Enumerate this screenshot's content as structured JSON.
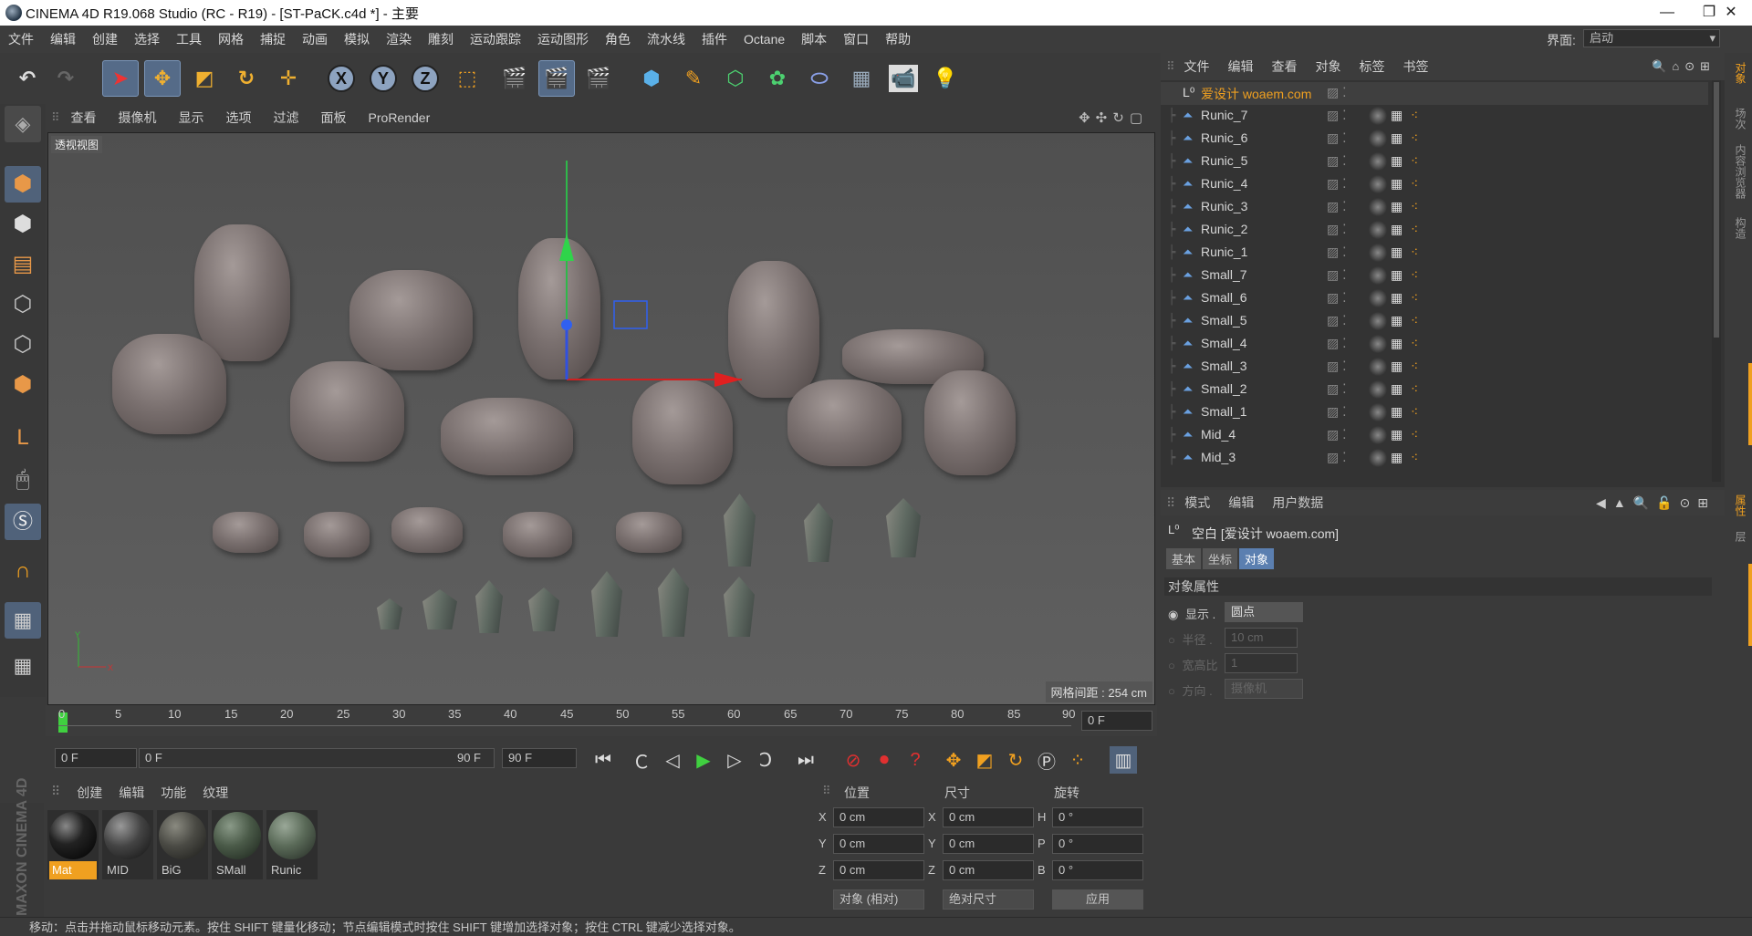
{
  "window": {
    "title": "CINEMA 4D R19.068 Studio (RC - R19) - [ST-PaCK.c4d *] - 主要",
    "minimize": "—",
    "restore": "❐",
    "close": "✕"
  },
  "menu": [
    "文件",
    "编辑",
    "创建",
    "选择",
    "工具",
    "网格",
    "捕捉",
    "动画",
    "模拟",
    "渲染",
    "雕刻",
    "运动跟踪",
    "运动图形",
    "角色",
    "流水线",
    "插件",
    "Octane",
    "脚本",
    "窗口",
    "帮助"
  ],
  "layout": {
    "label": "界面:",
    "value": "启动"
  },
  "toolbar": {
    "axis_x": "X",
    "axis_y": "Y",
    "axis_z": "Z"
  },
  "viewport": {
    "menu": [
      "查看",
      "摄像机",
      "显示",
      "选项",
      "过滤",
      "面板",
      "ProRender"
    ],
    "view_name": "透视视图",
    "grid_spacing": "网格间距 : 254 cm"
  },
  "timeline": {
    "ticks": [
      "0",
      "5",
      "10",
      "15",
      "20",
      "25",
      "30",
      "35",
      "40",
      "45",
      "50",
      "55",
      "60",
      "65",
      "70",
      "75",
      "80",
      "85",
      "90"
    ],
    "current_frame": "0 F"
  },
  "transport": {
    "start_field": "0 F",
    "range_start": "0 F",
    "range_end": "90 F",
    "end_field": "90 F"
  },
  "materials": {
    "menu": [
      "创建",
      "编辑",
      "功能",
      "纹理"
    ],
    "items": [
      {
        "name": "Mat"
      },
      {
        "name": "MID"
      },
      {
        "name": "BiG"
      },
      {
        "name": "SMall"
      },
      {
        "name": "Runic"
      }
    ]
  },
  "coords": {
    "headers": [
      "位置",
      "尺寸",
      "旋转"
    ],
    "rows": [
      {
        "a1": "X",
        "v1": "0 cm",
        "a2": "X",
        "v2": "0 cm",
        "a3": "H",
        "v3": "0 °"
      },
      {
        "a1": "Y",
        "v1": "0 cm",
        "a2": "Y",
        "v2": "0 cm",
        "a3": "P",
        "v3": "0 °"
      },
      {
        "a1": "Z",
        "v1": "0 cm",
        "a2": "Z",
        "v2": "0 cm",
        "a3": "B",
        "v3": "0 °"
      }
    ],
    "mode1": "对象 (相对)",
    "mode2": "绝对尺寸",
    "apply": "应用"
  },
  "object_manager": {
    "menu": [
      "文件",
      "编辑",
      "查看",
      "对象",
      "标签",
      "书签"
    ],
    "root": "爱设计 woaem.com",
    "objects": [
      "Runic_7",
      "Runic_6",
      "Runic_5",
      "Runic_4",
      "Runic_3",
      "Runic_2",
      "Runic_1",
      "Small_7",
      "Small_6",
      "Small_5",
      "Small_4",
      "Small_3",
      "Small_2",
      "Small_1",
      "Mid_4",
      "Mid_3"
    ]
  },
  "attribute_manager": {
    "menu": [
      "模式",
      "编辑",
      "用户数据"
    ],
    "object_title": "空白 [爱设计 woaem.com]",
    "tabs": [
      "基本",
      "坐标",
      "对象"
    ],
    "section": "对象属性",
    "props": [
      {
        "label": "显示 .",
        "value": "圆点"
      },
      {
        "label": "半径 .",
        "value": "10 cm"
      },
      {
        "label": "宽高比",
        "value": "1"
      },
      {
        "label": "方向 .",
        "value": "摄像机"
      }
    ]
  },
  "right_strip": [
    "对象",
    "场次",
    "内容浏览器",
    "构造",
    "属性",
    "层"
  ],
  "status": "移动：点击并拖动鼠标移动元素。按住 SHIFT 键量化移动；节点编辑模式时按住 SHIFT 键增加选择对象；按住 CTRL 键减少选择对象。",
  "branding": "MAXON CINEMA 4D",
  "colors": {
    "accent": "#f0a020",
    "active_tab": "#5b7fb0"
  }
}
